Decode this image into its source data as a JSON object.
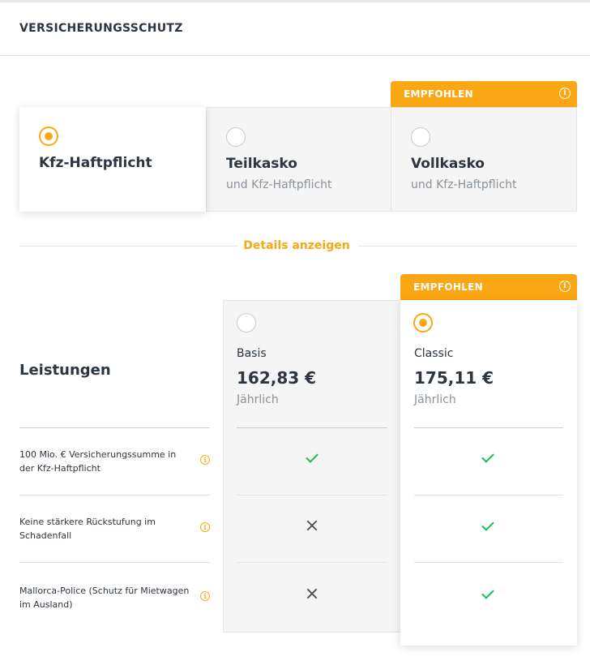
{
  "header": {
    "title": "VERSICHERUNGSSCHUTZ"
  },
  "badges": {
    "recommended": "EMPFOHLEN",
    "info_icon_glyph": "i"
  },
  "coverage_options": [
    {
      "title": "Kfz-Haftpflicht",
      "subtitle": "",
      "selected": true
    },
    {
      "title": "Teilkasko",
      "subtitle": "und Kfz-Haftpflicht",
      "selected": false
    },
    {
      "title": "Vollkasko",
      "subtitle": "und Kfz-Haftpflicht",
      "selected": false,
      "recommended": true
    }
  ],
  "details_link": "Details anzeigen",
  "comparison": {
    "heading": "Leistungen",
    "plans": [
      {
        "name": "Basis",
        "price": "162,83 €",
        "period": "Jährlich",
        "selected": false,
        "recommended": false
      },
      {
        "name": "Classic",
        "price": "175,11 €",
        "period": "Jährlich",
        "selected": true,
        "recommended": true
      }
    ],
    "features": [
      {
        "label": "100 Mio. € Versicherungssumme in der Kfz-Haftpflicht",
        "basis": "check",
        "classic": "check"
      },
      {
        "label": "Keine stärkere Rückstufung im Schadenfall",
        "basis": "cross",
        "classic": "check"
      },
      {
        "label": "Mallorca-Police (Schutz für Mietwagen im Ausland)",
        "basis": "cross",
        "classic": "check"
      }
    ]
  },
  "colors": {
    "accent": "#fba714",
    "check": "#1db954",
    "cross": "#4a545e",
    "text": "#2d3640",
    "muted": "#8a929a",
    "card_bg": "#f5f5f5",
    "border": "#e3e5e7"
  },
  "icons": [
    "info-icon",
    "radio-button",
    "check-icon",
    "cross-icon"
  ]
}
